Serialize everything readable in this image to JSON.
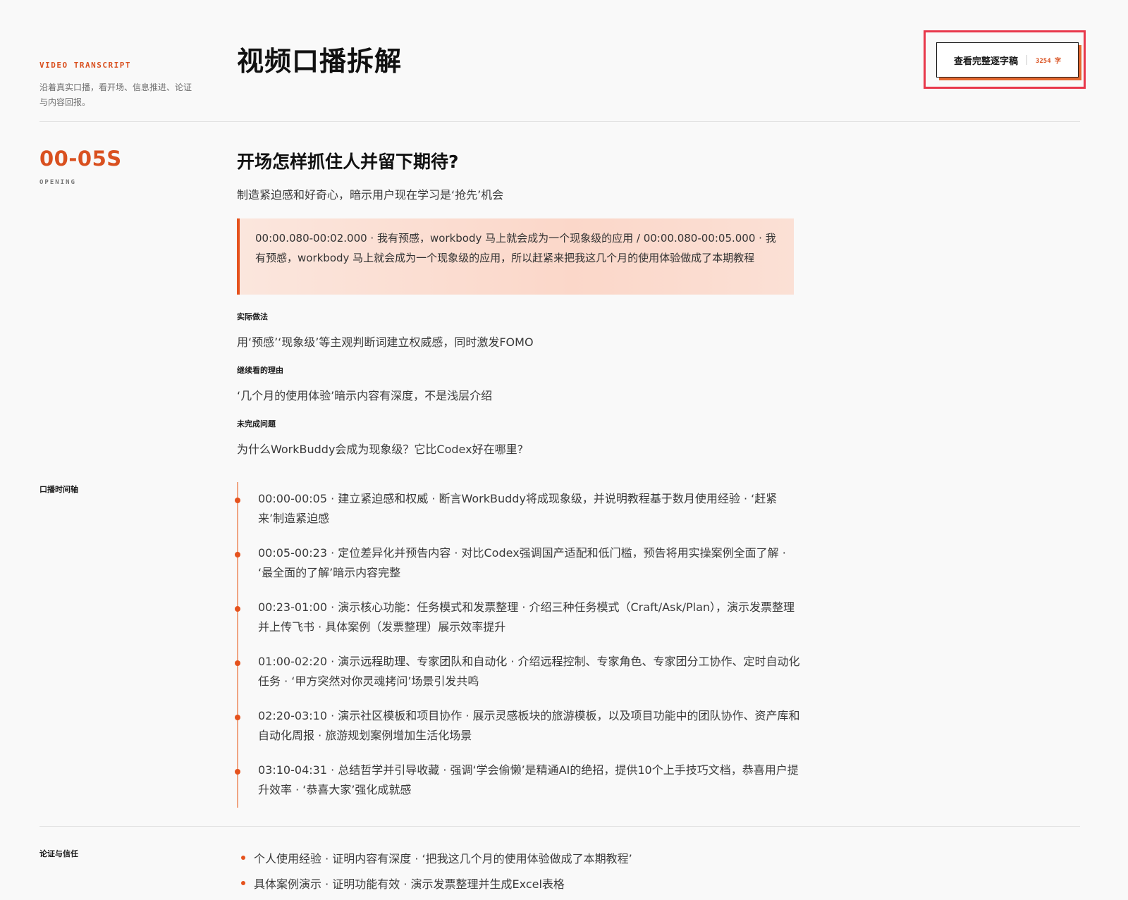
{
  "header": {
    "eyebrow": "VIDEO TRANSCRIPT",
    "intro": "沿着真实口播，看开场、信息推进、论证与内容回报。",
    "title": "视频口播拆解",
    "transcript_button": {
      "label": "查看完整逐字稿",
      "count": "3254 字"
    }
  },
  "opening": {
    "timecode": "00-05S",
    "tag": "OPENING",
    "title": "开场怎样抓住人并留下期待?",
    "subtitle": "制造紧迫感和好奇心，暗示用户现在学习是‘抢先’机会",
    "quote": "00:00.080-00:02.000 · 我有预感，workbody 马上就会成为一个现象级的应用 / 00:00.080-00:05.000 · 我有预感，workbody 马上就会成为一个现象级的应用，所以赶紧来把我这几个月的使用体验做成了本期教程",
    "fields": [
      {
        "label": "实际做法",
        "value": "用‘预感’‘现象级’等主观判断词建立权威感，同时激发FOMO"
      },
      {
        "label": "继续看的理由",
        "value": "‘几个月的使用体验’暗示内容有深度，不是浅层介绍"
      },
      {
        "label": "未完成问题",
        "value": "为什么WorkBuddy会成为现象级？它比Codex好在哪里?"
      }
    ]
  },
  "timeline": {
    "label": "口播时间轴",
    "items": [
      "00:00-00:05 · 建立紧迫感和权威 · 断言WorkBuddy将成现象级，并说明教程基于数月使用经验 · ‘赶紧来’制造紧迫感",
      "00:05-00:23 · 定位差异化并预告内容 · 对比Codex强调国产适配和低门槛，预告将用实操案例全面了解 · ‘最全面的了解’暗示内容完整",
      "00:23-01:00 · 演示核心功能：任务模式和发票整理 · 介绍三种任务模式（Craft/Ask/Plan），演示发票整理并上传飞书 · 具体案例（发票整理）展示效率提升",
      "01:00-02:20 · 演示远程助理、专家团队和自动化 · 介绍远程控制、专家角色、专家团分工协作、定时自动化任务 · ‘甲方突然对你灵魂拷问’场景引发共鸣",
      "02:20-03:10 · 演示社区模板和项目协作 · 展示灵感板块的旅游模板，以及项目功能中的团队协作、资产库和自动化周报 · 旅游规划案例增加生活化场景",
      "03:10-04:31 · 总结哲学并引导收藏 · 强调‘学会偷懒’是精通AI的绝招，提供10个上手技巧文档，恭喜用户提升效率 · ‘恭喜大家’强化成就感"
    ]
  },
  "evidence": {
    "label": "论证与信任",
    "items": [
      "个人使用经验 · 证明内容有深度 · ‘把我这几个月的使用体验做成了本期教程’",
      "具体案例演示 · 证明功能有效 · 演示发票整理并生成Excel表格"
    ]
  }
}
